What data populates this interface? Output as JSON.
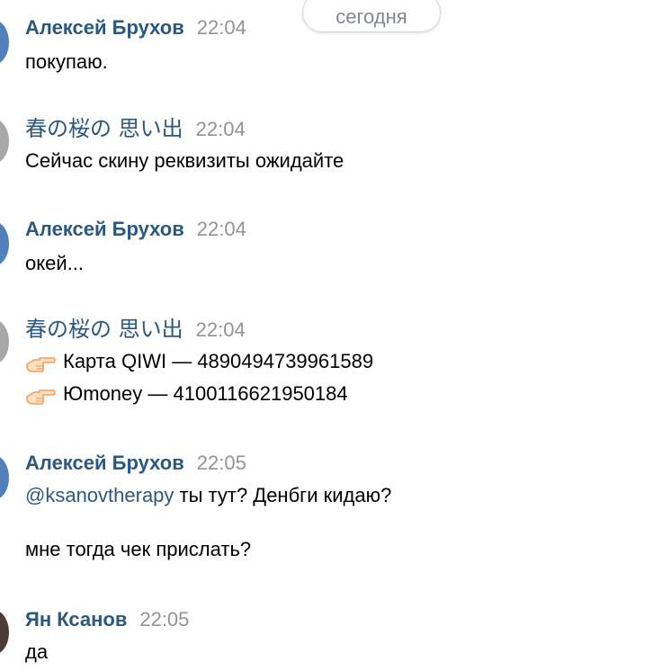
{
  "date_separator": "сегодня",
  "colors": {
    "author": "#2a5885",
    "time": "#939393",
    "text": "#000000",
    "emoji": "#f0a060"
  },
  "messages": [
    {
      "author": "Алексей Брухов",
      "time": "22:04",
      "lines": [
        "покупаю."
      ]
    },
    {
      "author": "春の桜の 思い出",
      "time": "22:04",
      "lines": [
        "Сейчас скину реквизиты ожидайте"
      ]
    },
    {
      "author": "Алексей Брухов",
      "time": "22:04",
      "lines": [
        "окей..."
      ]
    },
    {
      "author": "春の桜の 思い出",
      "time": "22:04",
      "lines": [
        {
          "icon": "pointing-hand-icon",
          "text": "Карта QIWI — 4890494739961589"
        },
        {
          "icon": "pointing-hand-icon",
          "text": "Юmoney — 4100116621950184"
        }
      ]
    },
    {
      "author": "Алексей Брухов",
      "time": "22:05",
      "mention": "@ksanovtherapy",
      "lines": [
        "ты тут? Денбги кидаю?",
        "мне тогда чек прислать?"
      ]
    },
    {
      "author": "Ян Ксанов",
      "time": "22:05",
      "lines": [
        "да"
      ]
    }
  ]
}
